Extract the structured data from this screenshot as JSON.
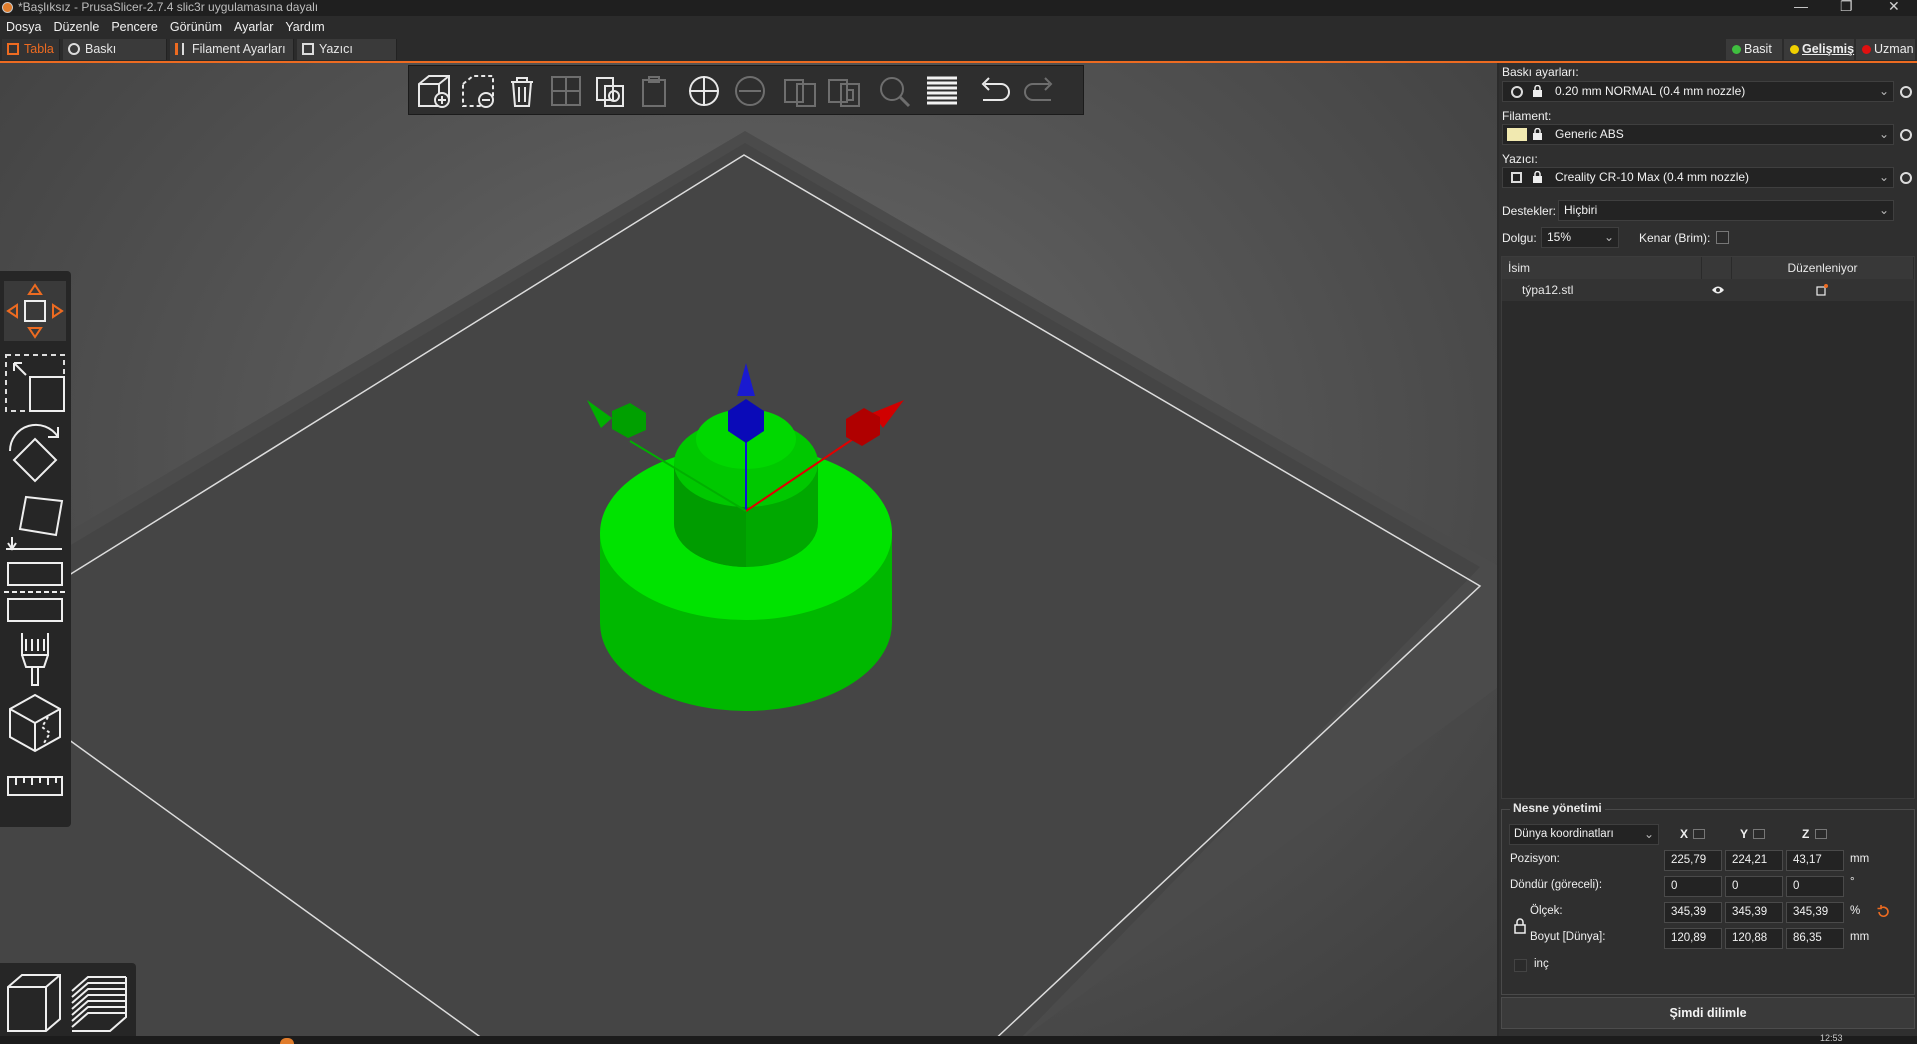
{
  "window": {
    "title": "*Başlıksız - PrusaSlicer-2.7.4 slic3r uygulamasına dayalı",
    "controls": [
      "—",
      "❐",
      "✕"
    ]
  },
  "menu": [
    "Dosya",
    "Düzenle",
    "Pencere",
    "Görünüm",
    "Ayarlar",
    "Yardım"
  ],
  "tabs": [
    {
      "label": "Tabla",
      "icon": "plater-icon",
      "active": true
    },
    {
      "label": "Baskı Ayarları",
      "icon": "cog-icon",
      "active": false
    },
    {
      "label": "Filament Ayarları",
      "icon": "spool-icon",
      "active": false
    },
    {
      "label": "Yazıcı ayarları",
      "icon": "printer-icon",
      "active": false
    }
  ],
  "modes": [
    {
      "label": "Basit",
      "color": "#3fbf3f",
      "active": false
    },
    {
      "label": "Gelişmiş",
      "color": "#f0d000",
      "active": true
    },
    {
      "label": "Uzman",
      "color": "#e01010",
      "active": false
    }
  ],
  "toolbar_icons": [
    "add-icon",
    "delete-icon",
    "delete-all-icon",
    "arrange-icon",
    "copy-icon",
    "paste-icon",
    "add-instance-icon",
    "remove-instance-icon",
    "split-objects-icon",
    "split-parts-icon",
    "search-icon",
    "layers-editing-icon",
    "undo-icon",
    "redo-icon"
  ],
  "left_tools": [
    "move-icon",
    "scale-icon",
    "rotate-icon",
    "place-on-face-icon",
    "cut-icon",
    "paint-supports-icon",
    "seam-painting-icon",
    "measure-icon"
  ],
  "view_buttons": [
    "3d-view-icon",
    "preview-icon"
  ],
  "settings": {
    "print_label": "Baskı ayarları:",
    "print_value": "0.20 mm NORMAL (0.4 mm nozzle)",
    "filament_label": "Filament:",
    "filament_value": "Generic ABS",
    "filament_color": "#f1e9b0",
    "printer_label": "Yazıcı:",
    "printer_value": "Creality CR-10 Max (0.4 mm nozzle)",
    "supports_label": "Destekler:",
    "supports_value": "Hiçbiri",
    "infill_label": "Dolgu:",
    "infill_value": "15%",
    "brim_label": "Kenar (Brim):"
  },
  "object_list": {
    "col_name": "İsim",
    "col_editing": "Düzenleniyor",
    "rows": [
      {
        "name": "týpa12.stl"
      }
    ]
  },
  "object_manipulation": {
    "title": "Nesne yönetimi",
    "coord_system": "Dünya koordinatları",
    "axes": [
      "X",
      "Y",
      "Z"
    ],
    "position_label": "Pozisyon:",
    "position": [
      "225,79",
      "224,21",
      "43,17"
    ],
    "position_unit": "mm",
    "rotate_label": "Döndür (göreceli):",
    "rotate": [
      "0",
      "0",
      "0"
    ],
    "rotate_unit": "°",
    "scale_label": "Ölçek:",
    "scale": [
      "345,39",
      "345,39",
      "345,39"
    ],
    "scale_unit": "%",
    "size_label": "Boyut [Dünya]:",
    "size": [
      "120,89",
      "120,88",
      "86,35"
    ],
    "size_unit": "mm",
    "inch_label": "inç"
  },
  "slice_button": "Şimdi dilimle",
  "taskbar": {
    "clock": "12:53"
  },
  "colors": {
    "accent": "#ed6b21",
    "model": "#00dd00",
    "bed": "#4a4a4a"
  }
}
